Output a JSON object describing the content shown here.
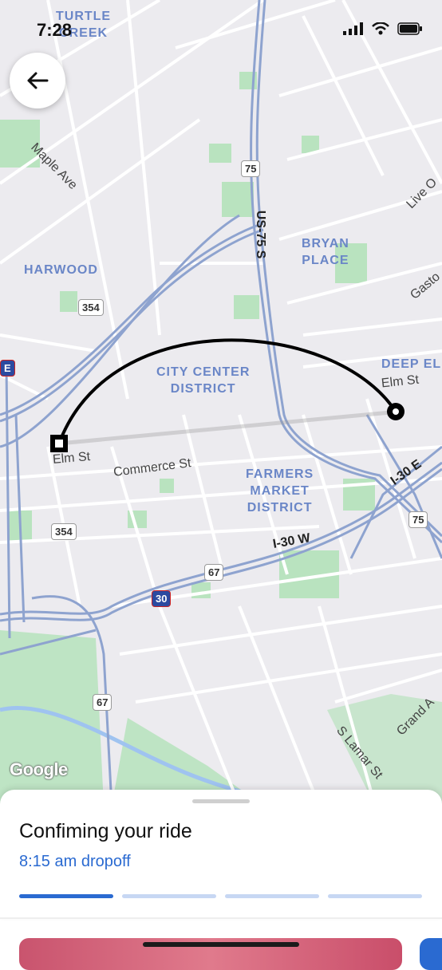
{
  "status": {
    "time": "7:28"
  },
  "map": {
    "areas": {
      "turtle_creek": "TURTLE\nCREEK",
      "harwood": "HARWOOD",
      "bryan_place": "BRYAN\nPLACE",
      "city_center": "CITY CENTER\nDISTRICT",
      "farmers_market": "FARMERS\nMARKET\nDISTRICT",
      "deep_ellum": "DEEP EL"
    },
    "streets": {
      "maple": "Maple Ave",
      "live_oak": "Live O",
      "gaston": "Gasto",
      "elm_west": "Elm St",
      "elm_east": "Elm St",
      "commerce": "Commerce St",
      "grand": "Grand A",
      "lamar": "S Lamar St"
    },
    "highways": {
      "us75s": "US-75 S",
      "i30w": "I-30 W",
      "i30e": "I-30 E"
    },
    "shields": {
      "s75_top": "75",
      "s354_a": "354",
      "s354_b": "354",
      "s67_a": "67",
      "s67_b": "67",
      "s75_right": "75",
      "s30": "30",
      "s_e_left": "E"
    },
    "attribution": "Google"
  },
  "sheet": {
    "title": "Confiming your ride",
    "subtitle": "8:15 am dropoff",
    "progress_steps": 4,
    "progress_active": 1
  },
  "colors": {
    "accent": "#2a6ad1",
    "map_bg": "#ecebef",
    "park": "#b9e3bf",
    "road_major": "#8ea3cf",
    "route": "#000000"
  }
}
